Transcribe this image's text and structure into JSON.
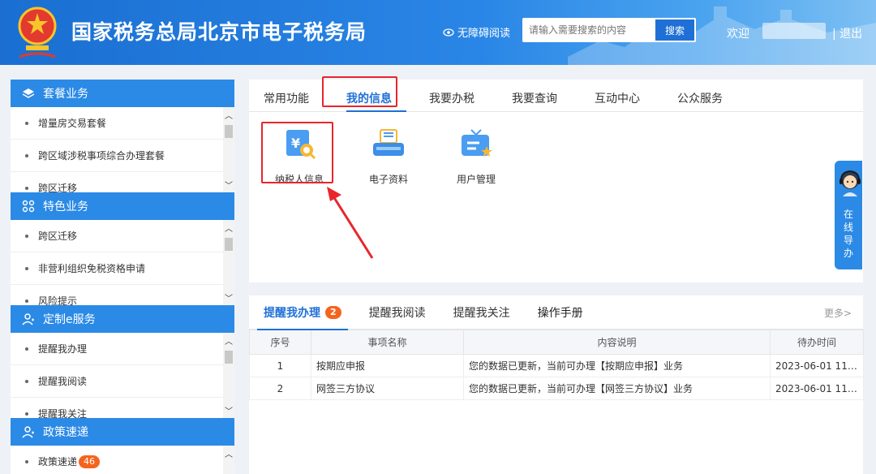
{
  "header": {
    "title": "国家税务总局北京市电子税务局",
    "accessibility_label": "无障碍阅读",
    "search_placeholder": "请输入需要搜索的内容",
    "search_button": "搜索",
    "welcome": "欢迎",
    "logout": "| 退出"
  },
  "sidebar": [
    {
      "title": "套餐业务",
      "icon": "layers-icon",
      "items": [
        "增量房交易套餐",
        "跨区域涉税事项综合办理套餐",
        "跨区迁移"
      ]
    },
    {
      "title": "特色业务",
      "icon": "grid-icon",
      "items": [
        "跨区迁移",
        "非营利组织免税资格申请",
        "风险提示"
      ]
    },
    {
      "title": "定制e服务",
      "icon": "user-icon",
      "items": [
        "提醒我办理",
        "提醒我阅读",
        "提醒我关注"
      ]
    },
    {
      "title": "政策速递",
      "icon": "user-icon",
      "items": [
        "政策速递"
      ],
      "badge": "46"
    }
  ],
  "main": {
    "tabs": [
      "常用功能",
      "我的信息",
      "我要办税",
      "我要查询",
      "互动中心",
      "公众服务"
    ],
    "active_tab": 1,
    "functions": [
      {
        "label": "纳税人信息",
        "icon": "taxpayer-info-icon"
      },
      {
        "label": "电子资料",
        "icon": "electronic-docs-icon"
      },
      {
        "label": "用户管理",
        "icon": "user-management-icon"
      }
    ]
  },
  "reminders": {
    "tabs": [
      "提醒我办理",
      "提醒我阅读",
      "提醒我关注",
      "操作手册"
    ],
    "active_badge": "2",
    "more": "更多>",
    "columns": [
      "序号",
      "事项名称",
      "内容说明",
      "待办时间"
    ],
    "rows": [
      [
        "1",
        "按期应申报",
        "您的数据已更新，当前可办理【按期应申报】业务",
        "2023-06-01 11:5..."
      ],
      [
        "2",
        "网签三方协议",
        "您的数据已更新，当前可办理【网签三方协议】业务",
        "2023-06-01 11:5..."
      ]
    ]
  },
  "guide": {
    "text": "在线导办"
  },
  "colors": {
    "primary": "#2b8ae6",
    "highlight": "#e8262b",
    "badge": "#f5641e"
  }
}
